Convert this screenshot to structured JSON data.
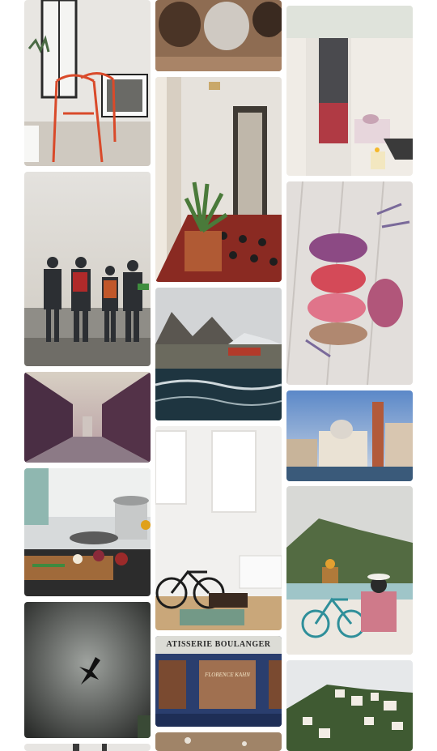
{
  "gallery": {
    "sign_top": "ATISSERIE   BOULANGER",
    "sign_middle": "FLORENCE KAHN"
  }
}
